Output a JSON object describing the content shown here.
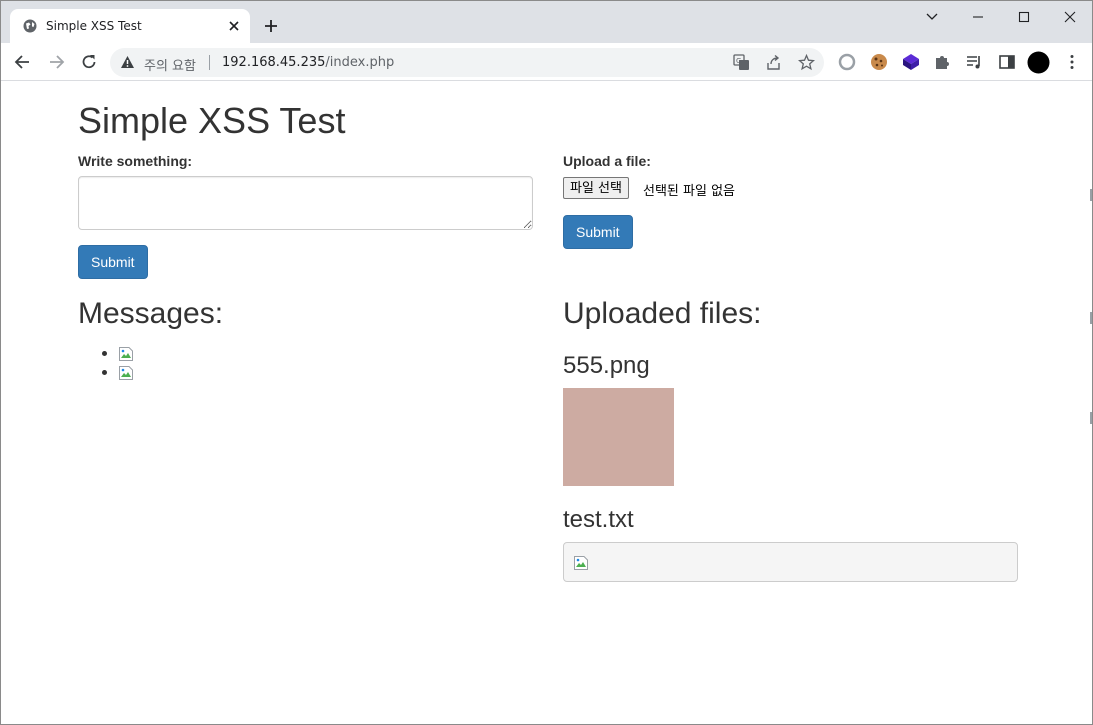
{
  "browser": {
    "tab_title": "Simple XSS Test",
    "security_label": "주의 요함",
    "url_host": "192.168.45.235",
    "url_path": "/index.php",
    "icons": [
      "globe-icon",
      "close-icon",
      "plus-icon",
      "chevron-down-icon",
      "minimize-icon",
      "maximize-icon",
      "window-close-icon",
      "back-icon",
      "forward-icon",
      "reload-icon",
      "warning-icon",
      "translate-icon",
      "share-icon",
      "star-icon",
      "circle-extension-icon",
      "cookie-icon",
      "cube-icon",
      "puzzle-icon",
      "media-icon",
      "side-panel-icon",
      "profile-icon",
      "kebab-menu-icon"
    ]
  },
  "page": {
    "title": "Simple XSS Test",
    "message_form": {
      "label": "Write something:",
      "value": "",
      "submit_label": "Submit"
    },
    "upload_form": {
      "label": "Upload a file:",
      "choose_button": "파일 선택",
      "no_file_text": "선택된 파일 없음",
      "submit_label": "Submit"
    },
    "messages": {
      "heading": "Messages:",
      "items": [
        "broken-image",
        "broken-image"
      ]
    },
    "uploads": {
      "heading": "Uploaded files:",
      "files": [
        {
          "name": "555.png",
          "kind": "image",
          "color": "#cdaba2"
        },
        {
          "name": "test.txt",
          "kind": "text"
        }
      ]
    }
  },
  "colors": {
    "primary": "#337ab7",
    "tab_strip": "#dee1e6"
  }
}
